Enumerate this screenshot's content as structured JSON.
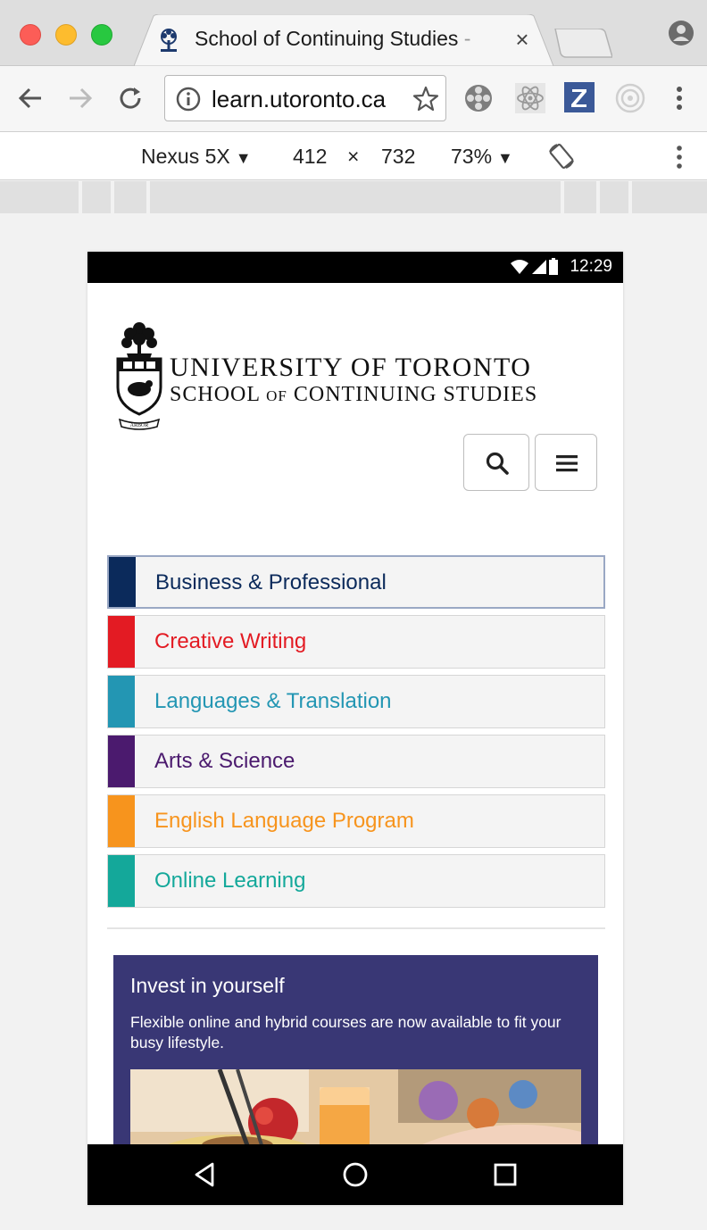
{
  "browser": {
    "tab_title": "School of Continuing Studies",
    "tab_fade": "-",
    "close_glyph": "×",
    "url": "learn.utoronto.ca"
  },
  "device_toolbar": {
    "device": "Nexus 5X",
    "width": "412",
    "times": "×",
    "height": "732",
    "zoom": "73%"
  },
  "status_bar": {
    "time": "12:29"
  },
  "logo": {
    "line1": "UNIVERSITY OF TORONTO",
    "line2_a": "SCHOOL",
    "line2_of": "OF",
    "line2_b": "CONTINUING STUDIES",
    "crest_scroll": "ARBOR"
  },
  "categories": [
    {
      "label": "Business & Professional",
      "color": "#0b2a5b"
    },
    {
      "label": "Creative Writing",
      "color": "#e31b23"
    },
    {
      "label": "Languages & Translation",
      "color": "#2396b3"
    },
    {
      "label": "Arts & Science",
      "color": "#4b1a6e"
    },
    {
      "label": "English Language Program",
      "color": "#f7941d"
    },
    {
      "label": "Online Learning",
      "color": "#14a89a"
    }
  ],
  "promo": {
    "title": "Invest in yourself",
    "text": "Flexible online and hybrid courses are now available to fit your busy lifestyle.",
    "background": "#393775"
  },
  "icons": {
    "favicon": "uoft-tree-icon",
    "extensions": [
      "film-reel-icon",
      "react-atom-icon",
      "z-icon",
      "target-icon"
    ]
  }
}
